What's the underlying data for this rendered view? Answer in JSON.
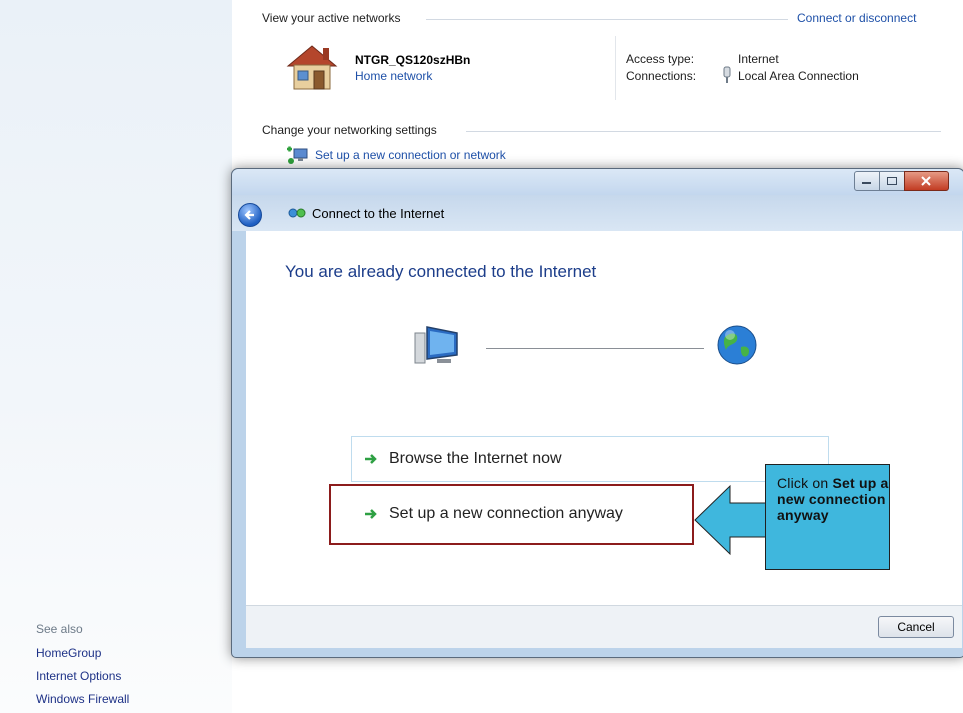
{
  "sidebar": {
    "see_also": "See also",
    "links": [
      "HomeGroup",
      "Internet Options",
      "Windows Firewall"
    ]
  },
  "networks": {
    "section_title": "View your active networks",
    "connect_link": "Connect or disconnect",
    "name": "NTGR_QS120szHBn",
    "type": "Home network",
    "access_label": "Access type:",
    "access_value": "Internet",
    "conn_label": "Connections:",
    "conn_value": "Local Area Connection"
  },
  "settings": {
    "section_title": "Change your networking settings",
    "setup_link": "Set up a new connection or network"
  },
  "dialog": {
    "title": "Connect to the Internet",
    "headline": "You are already connected to the Internet",
    "option1": "Browse the Internet now",
    "option2": "Set up a new connection anyway",
    "cancel": "Cancel"
  },
  "callout": {
    "prefix": "Click on ",
    "bold": "Set up a new connection anyway"
  },
  "colors": {
    "link": "#1e50a8",
    "highlight_border": "#8c1c1c",
    "callout_fill": "#3fb7dd"
  },
  "icons": [
    "house-icon",
    "plug-icon",
    "network-setup-icon",
    "back-arrow-icon",
    "globe-icon",
    "computer-icon",
    "green-arrow-icon",
    "callout-arrow"
  ]
}
